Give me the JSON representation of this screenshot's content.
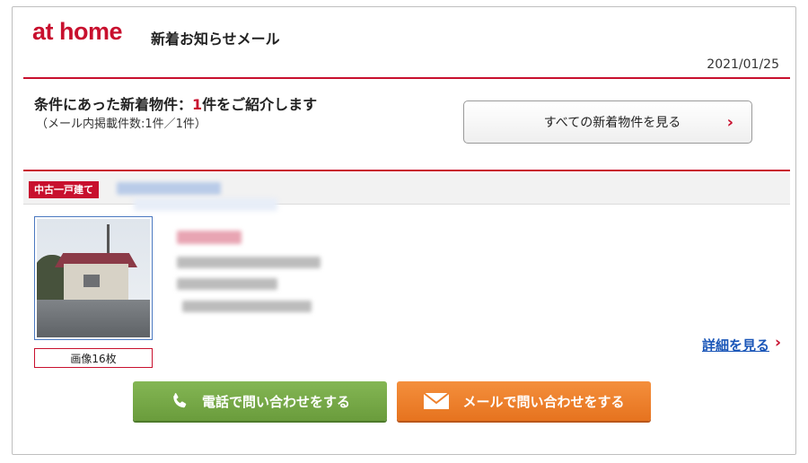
{
  "header": {
    "logo": "at home",
    "mail_title": "新着お知らせメール",
    "date": "2021/01/25"
  },
  "intro": {
    "title_prefix": "条件にあった新着物件：",
    "count": "1",
    "title_suffix": "件をご紹介します",
    "sub": "（メール内掲載件数:1件／1件）",
    "view_all_label": "すべての新着物件を見る"
  },
  "property": {
    "type_badge": "中古一戸建て",
    "image_count": "画像16枚",
    "detail_link": "詳細を見る"
  },
  "actions": {
    "phone_label": "電話で問い合わせをする",
    "mail_label": "メールで問い合わせをする"
  },
  "colors": {
    "brand": "#c8102e",
    "link": "#1a56b8",
    "phone_button": "#78aa46",
    "mail_button": "#ee812c"
  }
}
